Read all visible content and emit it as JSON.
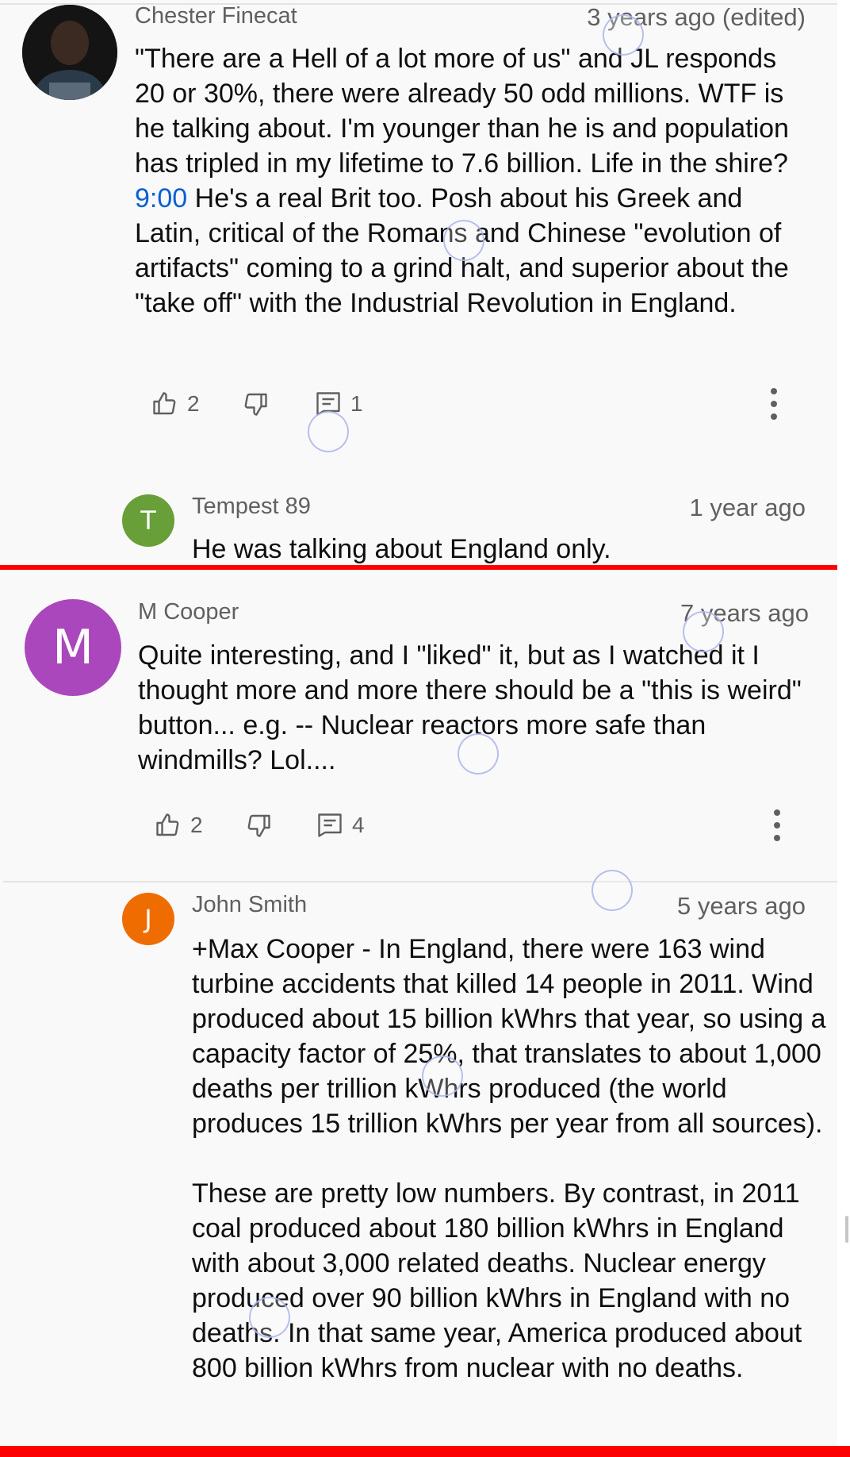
{
  "comments": [
    {
      "author": "Chester Finecat",
      "time": "3 years ago (edited)",
      "text_before": "\"There are a Hell of a lot more of us\" and JL responds 20 or 30%, there were already 50 odd millions. WTF is he talking about. I'm younger than he is and population has tripled in my lifetime to 7.6 billion. Life in the shire? ",
      "timestamp_link": "9:00",
      "text_after": " He's a real Brit too. Posh about his Greek and Latin, critical of the Romans and Chinese \"evolution of artifacts\" coming to a grind halt, and superior about the \"take off\" with the Industrial Revolution in England.",
      "likes": "2",
      "replies": "1"
    },
    {
      "author": "Tempest 89",
      "avatar_letter": "T",
      "avatar_color": "#689f38",
      "time": "1 year ago",
      "text": "He was talking about England only."
    },
    {
      "author": "M Cooper",
      "avatar_letter": "M",
      "avatar_color": "#ab47bc",
      "time": "7 years ago",
      "text": "Quite interesting, and I \"liked\" it, but as I watched it I thought more and more there should be a \"this is weird\" button... e.g. -- Nuclear reactors more safe than windmills? Lol....",
      "likes": "2",
      "replies": "4"
    },
    {
      "author": "John Smith",
      "avatar_letter": "J",
      "avatar_color": "#ef6c00",
      "time": "5 years ago",
      "text": "+Max Cooper - In England, there were 163 wind turbine accidents that killed 14 people in 2011. Wind produced about 15 billion kWhrs that year, so using a capacity factor of 25%, that translates to about 1,000 deaths per trillion kWhrs produced (the world produces 15 trillion kWhrs per year from all sources).\n\nThese are pretty low numbers. By contrast, in 2011 coal produced about 180 billion kWhrs in England with about 3,000 related deaths. Nuclear energy produced over 90 billion kWhrs in England with no deaths. In that same year, America produced about 800 billion kWhrs from nuclear with no deaths."
    }
  ],
  "icons": {
    "like": "thumb-up-icon",
    "dislike": "thumb-down-icon",
    "reply": "comment-icon",
    "menu": "more-vert-icon"
  },
  "colors": {
    "background": "#f9f9f9",
    "link": "#065fd4",
    "secondary_text": "#606060",
    "highlight_line": "#ff0000"
  }
}
